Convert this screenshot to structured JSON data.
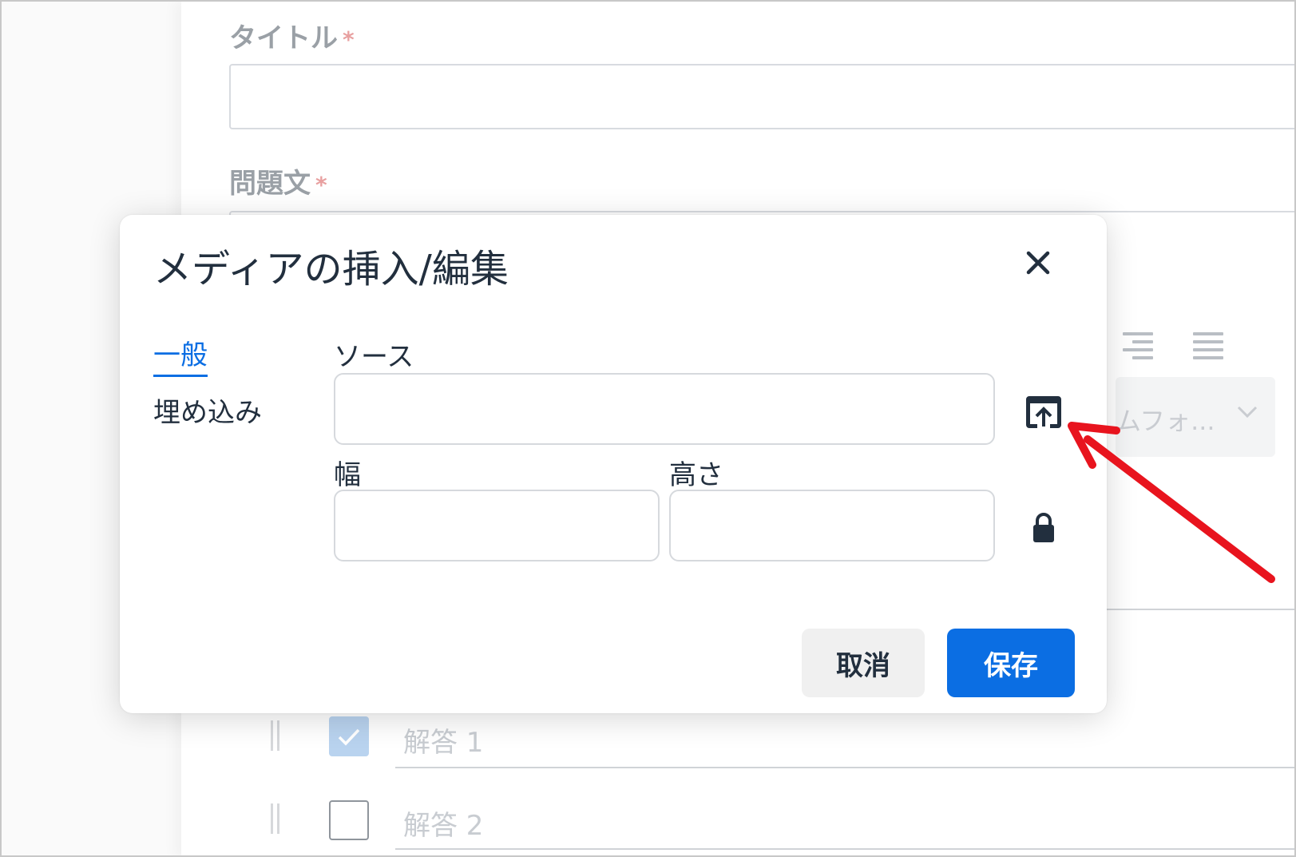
{
  "background": {
    "title_label": "タイトル",
    "question_label": "問題文",
    "required_mark": "*",
    "select_placeholder": "ムフォ...",
    "answers": [
      {
        "label": "解答 1",
        "checked": true
      },
      {
        "label": "解答 2",
        "checked": false
      }
    ]
  },
  "dialog": {
    "title": "メディアの挿入/編集",
    "close_icon": "close-icon",
    "tabs": [
      {
        "label": "一般",
        "active": true
      },
      {
        "label": "埋め込み",
        "active": false
      }
    ],
    "fields": {
      "source_label": "ソース",
      "source_value": "",
      "width_label": "幅",
      "width_value": "",
      "height_label": "高さ",
      "height_value": ""
    },
    "upload_icon": "upload-icon",
    "lock_icon": "lock-icon",
    "buttons": {
      "cancel": "取消",
      "save": "保存"
    }
  },
  "colors": {
    "accent": "#0b6ee3",
    "annotation_arrow": "#e8141e",
    "text": "#222f3e"
  }
}
